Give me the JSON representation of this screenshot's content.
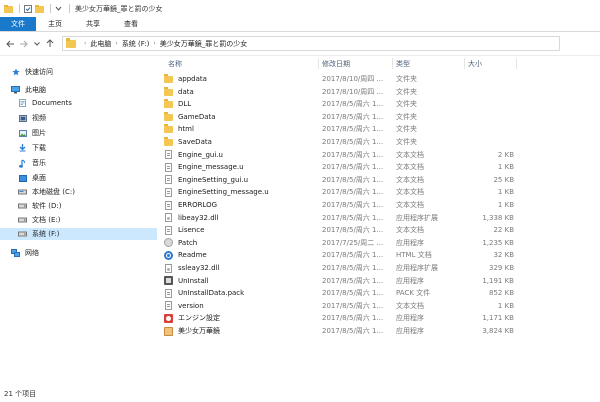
{
  "window": {
    "title": "美少女万華鏡_罪と罰の少女"
  },
  "ribbon": {
    "tabs": [
      "文件",
      "主页",
      "共享",
      "查看"
    ]
  },
  "address": {
    "path": [
      "此电脑",
      "系统 (F:)",
      "美少女万華鏡_罪と罰の少女"
    ]
  },
  "sidebar": {
    "items": [
      {
        "label": "快速访问",
        "icon": "star-icon"
      },
      {
        "label": "此电脑",
        "icon": "computer-icon"
      },
      {
        "label": "Documents",
        "icon": "documents-icon"
      },
      {
        "label": "视频",
        "icon": "video-icon"
      },
      {
        "label": "图片",
        "icon": "pictures-icon"
      },
      {
        "label": "下载",
        "icon": "download-icon"
      },
      {
        "label": "音乐",
        "icon": "music-icon"
      },
      {
        "label": "桌面",
        "icon": "desktop-icon"
      },
      {
        "label": "本地磁盘 (C:)",
        "icon": "drive-icon"
      },
      {
        "label": "软件 (D:)",
        "icon": "drive-icon"
      },
      {
        "label": "文档 (E:)",
        "icon": "drive-icon"
      },
      {
        "label": "系统 (F:)",
        "icon": "drive-icon"
      },
      {
        "label": "网络",
        "icon": "network-icon"
      }
    ]
  },
  "columns": {
    "name": "名称",
    "date": "修改日期",
    "type": "类型",
    "size": "大小"
  },
  "files": [
    {
      "name": "appdata",
      "date": "2017/8/10/周四 ...",
      "type": "文件夹",
      "size": "",
      "icon": "folder"
    },
    {
      "name": "data",
      "date": "2017/8/10/周四 ...",
      "type": "文件夹",
      "size": "",
      "icon": "folder"
    },
    {
      "name": "DLL",
      "date": "2017/8/5/周六 1...",
      "type": "文件夹",
      "size": "",
      "icon": "folder"
    },
    {
      "name": "GameData",
      "date": "2017/8/5/周六 1...",
      "type": "文件夹",
      "size": "",
      "icon": "folder"
    },
    {
      "name": "html",
      "date": "2017/8/5/周六 1...",
      "type": "文件夹",
      "size": "",
      "icon": "folder"
    },
    {
      "name": "SaveData",
      "date": "2017/8/5/周六 1...",
      "type": "文件夹",
      "size": "",
      "icon": "folder"
    },
    {
      "name": "Engine_gui.u",
      "date": "2017/8/5/周六 1...",
      "type": "文本文档",
      "size": "2 KB",
      "icon": "doc"
    },
    {
      "name": "Engine_message.u",
      "date": "2017/8/5/周六 1...",
      "type": "文本文档",
      "size": "1 KB",
      "icon": "doc"
    },
    {
      "name": "EngineSetting_gui.u",
      "date": "2017/8/5/周六 1...",
      "type": "文本文档",
      "size": "25 KB",
      "icon": "doc"
    },
    {
      "name": "EngineSetting_message.u",
      "date": "2017/8/5/周六 1...",
      "type": "文本文档",
      "size": "1 KB",
      "icon": "doc"
    },
    {
      "name": "ERRORLOG",
      "date": "2017/8/5/周六 1...",
      "type": "文本文档",
      "size": "1 KB",
      "icon": "doc"
    },
    {
      "name": "libeay32.dll",
      "date": "2017/8/5/周六 1...",
      "type": "应用程序扩展",
      "size": "1,338 KB",
      "icon": "dll"
    },
    {
      "name": "Lisence",
      "date": "2017/8/5/周六 1...",
      "type": "文本文档",
      "size": "22 KB",
      "icon": "doc"
    },
    {
      "name": "Patch",
      "date": "2017/7/25/周二 ...",
      "type": "应用程序",
      "size": "1,235 KB",
      "icon": "patch"
    },
    {
      "name": "Readme",
      "date": "2017/8/5/周六 1...",
      "type": "HTML 文档",
      "size": "32 KB",
      "icon": "html"
    },
    {
      "name": "ssleay32.dll",
      "date": "2017/8/5/周六 1...",
      "type": "应用程序扩展",
      "size": "329 KB",
      "icon": "dll"
    },
    {
      "name": "UnInstall",
      "date": "2017/8/5/周六 1...",
      "type": "应用程序",
      "size": "1,191 KB",
      "icon": "uninst"
    },
    {
      "name": "UnInstallData.pack",
      "date": "2017/8/5/周六 1...",
      "type": "PACK 文件",
      "size": "852 KB",
      "icon": "doc"
    },
    {
      "name": "version",
      "date": "2017/8/5/周六 1...",
      "type": "文本文档",
      "size": "1 KB",
      "icon": "doc"
    },
    {
      "name": "エンジン設定",
      "date": "2017/8/5/周六 1...",
      "type": "应用程序",
      "size": "1,171 KB",
      "icon": "setting"
    },
    {
      "name": "美少女万華鏡",
      "date": "2017/8/5/周六 1...",
      "type": "应用程序",
      "size": "3,824 KB",
      "icon": "game"
    }
  ],
  "status": {
    "count": "21 个项目"
  }
}
